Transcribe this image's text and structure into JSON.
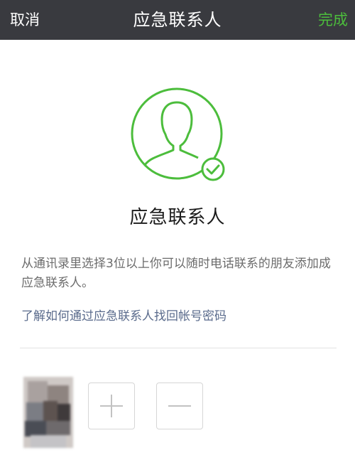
{
  "navbar": {
    "cancel_label": "取消",
    "title": "应急联系人",
    "done_label": "完成"
  },
  "main": {
    "heading": "应急联系人",
    "description": "从通讯录里选择3位以上你可以随时电话联系的朋友添加成应急联系人。",
    "help_link": "了解如何通过应急联系人找回帐号密码"
  },
  "contacts": {
    "avatar_icon": "blurred-contact-photo",
    "add_icon": "plus-icon",
    "remove_icon": "minus-icon"
  },
  "colors": {
    "navbar_bg": "#393a3f",
    "accent_green": "#4cbd3c",
    "link_blue": "#5a6b8c",
    "text_gray": "#6c6c6c"
  }
}
